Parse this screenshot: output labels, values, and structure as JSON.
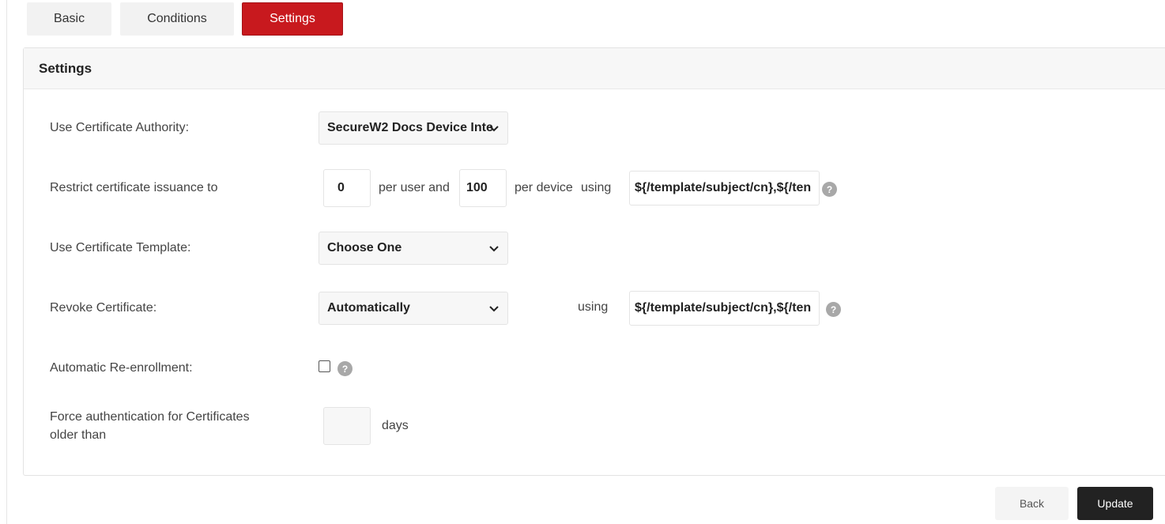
{
  "tabs": [
    {
      "label": "Basic"
    },
    {
      "label": "Conditions"
    },
    {
      "label": "Settings"
    }
  ],
  "panel": {
    "title": "Settings"
  },
  "form": {
    "ca_label": "Use Certificate Authority:",
    "ca_value": "SecureW2 Docs Device Inte",
    "restrict_label": "Restrict certificate issuance to",
    "per_user_value": "0",
    "per_user_text": "per user and",
    "per_device_value": "100",
    "per_device_text": "per device",
    "using_text": "using",
    "restrict_using_value": "${/template/subject/cn},${/ten",
    "template_label": "Use Certificate Template:",
    "template_value": "Choose One",
    "revoke_label": "Revoke Certificate:",
    "revoke_value": "Automatically",
    "revoke_using_text": "using",
    "revoke_using_value": "${/template/subject/cn},${/ten",
    "reenroll_label": "Automatic Re-enrollment:",
    "force_label_line1": "Force authentication for Certificates",
    "force_label_line2": "older than",
    "force_days_value": "",
    "days_text": "days",
    "help_glyph": "?"
  },
  "buttons": {
    "back": "Back",
    "update": "Update"
  },
  "colors": {
    "accent": "#c8191e",
    "update_bg": "#222222"
  }
}
